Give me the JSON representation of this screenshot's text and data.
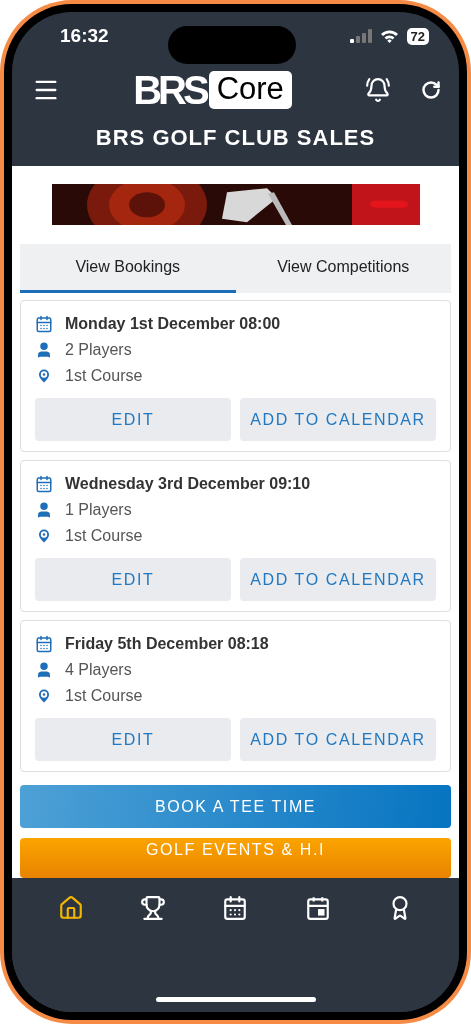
{
  "status_bar": {
    "time": "16:32",
    "battery": "72"
  },
  "header": {
    "logo": {
      "brand": "BRS",
      "product": "Core"
    },
    "title": "BRS GOLF CLUB SALES"
  },
  "tabs": [
    {
      "label": "View Bookings",
      "selected": true
    },
    {
      "label": "View Competitions",
      "selected": false
    }
  ],
  "bookings": [
    {
      "date": "Monday 1st December 08:00",
      "players": "2 Players",
      "course": "1st Course",
      "buttons": [
        "EDIT",
        "ADD TO CALENDAR"
      ]
    },
    {
      "date": "Wednesday 3rd December 09:10",
      "players": "1 Players",
      "course": "1st Course",
      "buttons": [
        "EDIT",
        "ADD TO CALENDAR"
      ]
    },
    {
      "date": "Friday 5th December 08:18",
      "players": "4 Players",
      "course": "1st Course",
      "buttons": [
        "EDIT",
        "ADD TO CALENDAR"
      ]
    }
  ],
  "actions": [
    {
      "kind": "primary",
      "label": "BOOK A TEE TIME"
    },
    {
      "kind": "warning",
      "label": "GOLF EVENTS & H.I"
    }
  ],
  "nav": [
    {
      "kind": "home",
      "selected": true
    },
    {
      "kind": "trophy",
      "selected": false
    },
    {
      "kind": "calendar",
      "selected": false
    },
    {
      "kind": "day",
      "selected": false
    },
    {
      "kind": "award",
      "selected": false
    }
  ]
}
